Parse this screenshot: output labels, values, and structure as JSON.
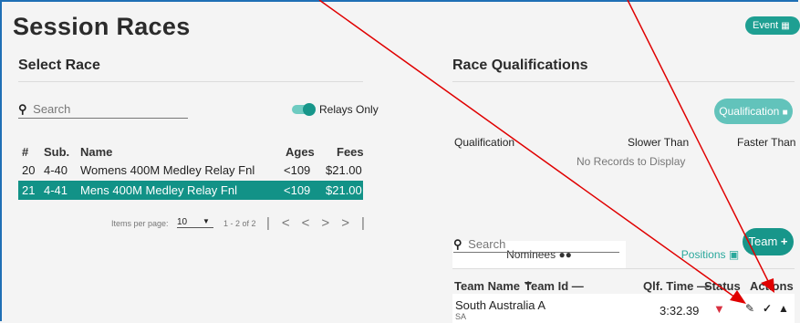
{
  "page": {
    "title": "Session Races",
    "event_button": "Event"
  },
  "select_race": {
    "title": "Select Race",
    "search_placeholder": "Search",
    "relays_only_label": "Relays Only",
    "columns": [
      "#",
      "Sub.",
      "Name",
      "Ages",
      "Fees"
    ],
    "rows": [
      {
        "num": "20",
        "sub": "4-40",
        "name": "Womens 400M Medley Relay Fnl",
        "ages": "<109",
        "fees": "$21.00"
      },
      {
        "num": "21",
        "sub": "4-41",
        "name": "Mens 400M Medley Relay Fnl",
        "ages": "<109",
        "fees": "$21.00"
      }
    ],
    "pagination": {
      "items_per_page_label": "Items per page:",
      "items_per_page": "10",
      "range": "1 - 2 of 2"
    }
  },
  "race_qualifications": {
    "title": "Race Qualifications",
    "qualification_button": "Qualification",
    "columns": [
      "Qualification",
      "Slower Than",
      "Faster Than"
    ],
    "empty_text": "No Records to Display"
  },
  "tabs": {
    "nominees": "Nominees",
    "positions": "Positions"
  },
  "nominees": {
    "search_placeholder": "Search",
    "team_button": "Team",
    "columns": {
      "team_name": "Team Name",
      "team_id": "Team Id",
      "qlf_time": "Qlf. Time",
      "status": "Status",
      "actions": "Actions"
    },
    "rows": [
      {
        "team_name": "South Australia A",
        "team_sub": "SA",
        "qlf_time": "3:32.39"
      }
    ]
  },
  "colors": {
    "accent": "#129287",
    "accent_light": "#62c3bb",
    "annotation": "#e00000",
    "frame": "#1f6fb5"
  },
  "icons": [
    "calendar-icon",
    "search-icon",
    "lock-icon",
    "users-icon",
    "positions-icon",
    "plus-icon",
    "cart-icon",
    "edit-icon",
    "trash-icon",
    "sort-up-icon",
    "dash-icon"
  ]
}
